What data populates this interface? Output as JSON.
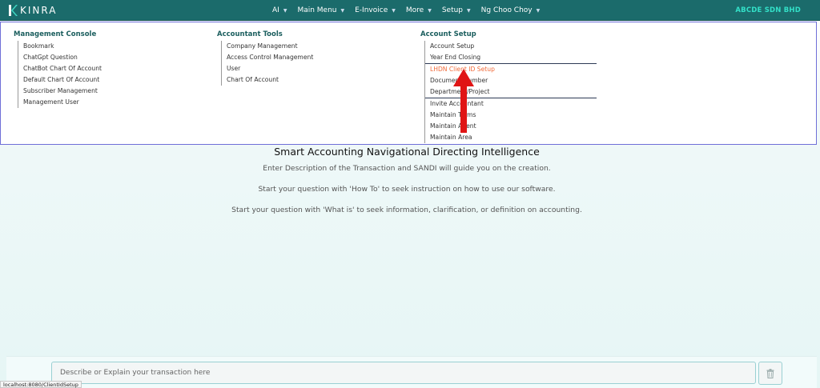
{
  "header": {
    "logo_text": "KINRA",
    "company": "ABCDE SDN BHD",
    "nav": [
      {
        "label": "AI"
      },
      {
        "label": "Main Menu"
      },
      {
        "label": "E-Invoice"
      },
      {
        "label": "More"
      },
      {
        "label": "Setup"
      },
      {
        "label": "Ng Choo Choy"
      }
    ]
  },
  "mega_menu": {
    "management_console": {
      "heading": "Management Console",
      "items": [
        "Bookmark",
        "ChatGpt Question",
        "ChatBot Chart Of Account",
        "Default Chart Of Account",
        "Subscriber Management",
        "Management User"
      ]
    },
    "accountant_tools": {
      "heading": "Accountant Tools",
      "items": [
        "Company Management",
        "Access Control Management",
        "User",
        "Chart Of Account"
      ]
    },
    "account_setup": {
      "heading": "Account Setup",
      "items": [
        "Account Setup",
        "Year End Closing",
        "LHDN Client ID Setup",
        "Document Number",
        "Department/Project",
        "Invite Accountant",
        "Maintain Terms",
        "Maintain Agent",
        "Maintain Area"
      ]
    }
  },
  "info": {
    "title": "Smart Accounting Navigational Directing Intelligence",
    "line1": "Enter Description of the Transaction and SANDI will guide you on the creation.",
    "line2": "Start your question with 'How To' to seek instruction on how to use our software.",
    "line3": "Start your question with 'What is' to seek information, clarification, or definition on accounting."
  },
  "input": {
    "placeholder": "Describe or Explain your transaction here"
  },
  "status_url": "localhost:8080/ClientIdSetup",
  "colors": {
    "navbar": "#1b6b6b",
    "company": "#33e0c8",
    "active_item": "#f06a3a",
    "arrow": "#e01515"
  }
}
